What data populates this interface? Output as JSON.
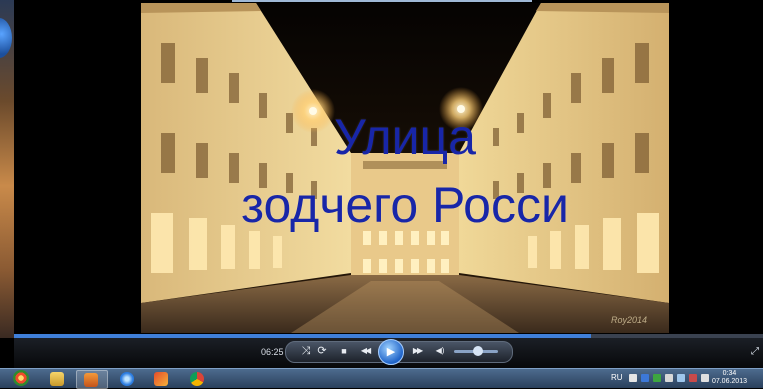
{
  "video": {
    "title_line1": "Улица",
    "title_line2": "зодчего Росси",
    "signature": "Roy2014"
  },
  "controls": {
    "elapsed_time": "06:25",
    "progress_fraction": 0.77,
    "volume_fraction": 0.55,
    "buttons": {
      "shuffle": "⤨",
      "repeat": "⟳",
      "stop": "■",
      "previous": "◀◀",
      "play": "▶",
      "next": "▶▶",
      "mute": "◀)",
      "fullscreen": "⤢"
    }
  },
  "taskbar": {
    "language": "RU",
    "clock_time": "0:34",
    "clock_date": "07.06.2013",
    "pinned_icons": [
      "windows-start-icon",
      "file-explorer-icon",
      "media-player-icon",
      "internet-explorer-icon",
      "games-icon",
      "chrome-icon"
    ]
  }
}
